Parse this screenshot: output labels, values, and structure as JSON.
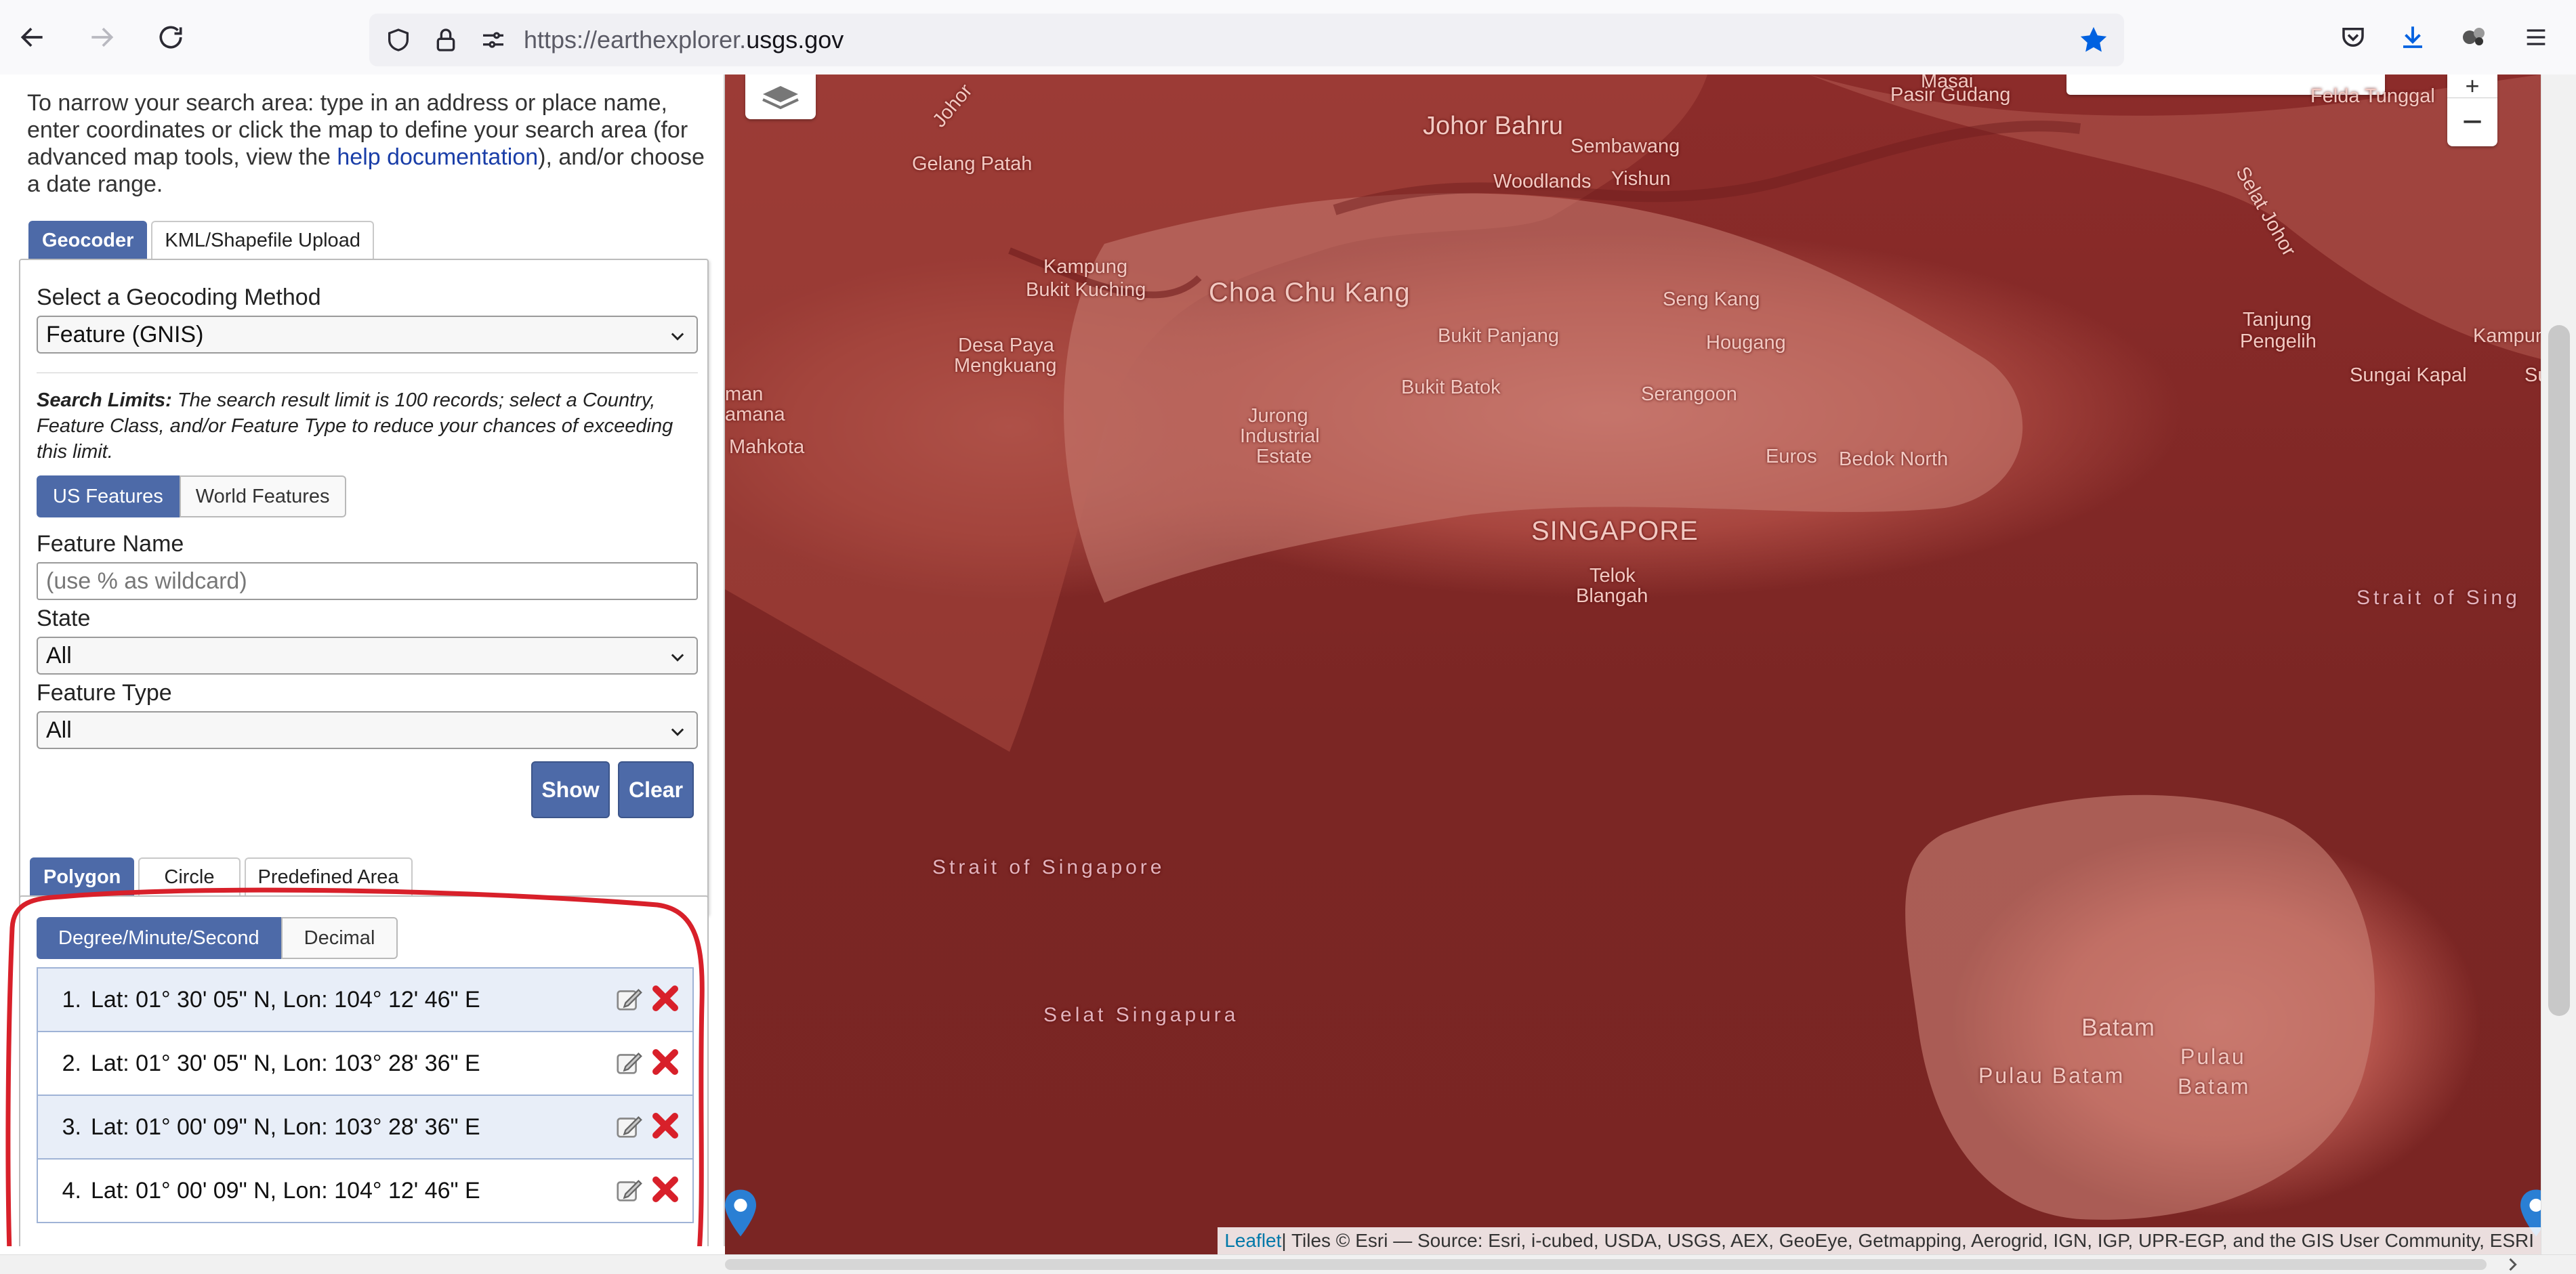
{
  "browser": {
    "url_prefix": "https://earthexplorer.",
    "url_host": "usgs.gov",
    "icons": [
      "back-icon",
      "forward-icon",
      "reload-icon",
      "shield-icon",
      "lock-icon",
      "permissions-icon",
      "bookmark-star-icon",
      "pocket-icon",
      "download-icon",
      "extensions-icon",
      "menu-icon"
    ]
  },
  "panel": {
    "intro_before_link": "To narrow your search area: type in an address or place name, enter coordinates or click the map to define your search area (for advanced map tools, view the ",
    "intro_link": "help documentation",
    "intro_after_link": "), and/or choose a date range.",
    "tabs": [
      "Geocoder",
      "KML/Shapefile Upload"
    ],
    "active_tab": "Geocoder",
    "geocoding_label": "Select a Geocoding Method",
    "geocoding_value": "Feature (GNIS)",
    "limits_bold": "Search Limits:",
    "limits_text": " The search result limit is 100 records; select a Country, Feature Class, and/or Feature Type to reduce your chances of exceeding this limit.",
    "feature_toggle": [
      "US Features",
      "World Features"
    ],
    "feature_name_label": "Feature Name",
    "feature_name_placeholder": "(use % as wildcard)",
    "state_label": "State",
    "state_value": "All",
    "feature_type_label": "Feature Type",
    "feature_type_value": "All",
    "show_button": "Show",
    "clear_button": "Clear"
  },
  "area": {
    "tabs": [
      "Polygon",
      "Circle",
      "Predefined Area"
    ],
    "active_tab": "Polygon",
    "format_toggle": [
      "Degree/Minute/Second",
      "Decimal"
    ],
    "coordinates": [
      {
        "num": "1.",
        "text": "Lat: 01° 30' 05\" N, Lon: 104° 12' 46\" E"
      },
      {
        "num": "2.",
        "text": "Lat: 01° 30' 05\" N, Lon: 103° 28' 36\" E"
      },
      {
        "num": "3.",
        "text": "Lat: 01° 00' 09\" N, Lon: 103° 28' 36\" E"
      },
      {
        "num": "4.",
        "text": "Lat: 01° 00' 09\" N, Lon: 104° 12' 46\" E"
      }
    ],
    "annotation_color": "#d8202a"
  },
  "map": {
    "labels": [
      "Johor Bahru",
      "Pasir Gudang",
      "Masai",
      "Gelang Patah",
      "Sembawang",
      "Woodlands",
      "Yishun",
      "Kampung",
      "Bukit Kuching",
      "Choa Chu Kang",
      "Seng Kang",
      "Bukit Panjang",
      "Hougang",
      "Desa Paya",
      "Mengkuang",
      "Bukit Batok",
      "Serangoon",
      "Jurong",
      "Industrial",
      "Estate",
      "Euros",
      "Bedok North",
      "SINGAPORE",
      "Telok",
      "Blangah",
      "Tanjung",
      "Pengelih",
      "Kampun",
      "Sungai Kapal",
      "Strait of Singapore",
      "Selat Singapura",
      "Strait of Sing",
      "Batam",
      "Pulau Batam",
      "Pulau",
      "Batam",
      "Mahkota",
      "Felda Tunggal",
      "Selat Johor",
      "Johor",
      "man",
      "amana",
      "Su"
    ],
    "attribution_link": "Leaflet",
    "attribution_text": " | Tiles © Esri — Source: Esri, i-cubed, USDA, USGS, AEX, GeoEye, Getmapping, Aerogrid, IGN, IGP, UPR-EGP, and the GIS User Community, ESRI",
    "zoom_in": "+",
    "zoom_out": "−",
    "tint_color": "#8c2c2a"
  }
}
